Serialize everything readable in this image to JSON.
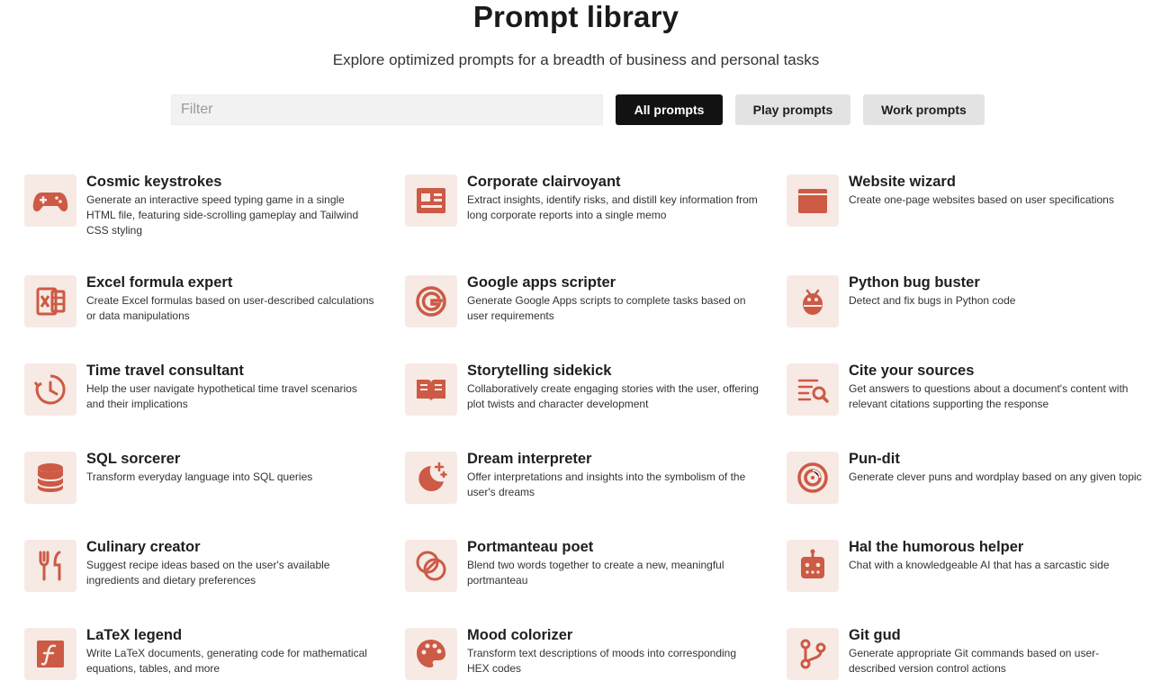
{
  "header": {
    "title": "Prompt library",
    "subtitle": "Explore optimized prompts for a breadth of business and personal tasks"
  },
  "filter": {
    "placeholder": "Filter",
    "value": ""
  },
  "tabs": {
    "all": "All prompts",
    "play": "Play prompts",
    "work": "Work prompts"
  },
  "colors": {
    "accent": "#cc5a45",
    "icon_bg": "#f7e9e4",
    "active_tab": "#121212",
    "inactive_tab": "#e3e3e3"
  },
  "cards": [
    {
      "title": "Cosmic keystrokes",
      "description": "Generate an interactive speed typing game in a single HTML file, featuring side-scrolling gameplay and Tailwind CSS styling",
      "icon": "gamepad-icon"
    },
    {
      "title": "Corporate clairvoyant",
      "description": "Extract insights, identify risks, and distill key information from long corporate reports into a single memo",
      "icon": "newspaper-icon"
    },
    {
      "title": "Website wizard",
      "description": "Create one-page websites based on user specifications",
      "icon": "browser-window-icon"
    },
    {
      "title": "Excel formula expert",
      "description": "Create Excel formulas based on user-described calculations or data manipulations",
      "icon": "excel-icon"
    },
    {
      "title": "Google apps scripter",
      "description": "Generate Google Apps scripts to complete tasks based on user requirements",
      "icon": "google-icon"
    },
    {
      "title": "Python bug buster",
      "description": "Detect and fix bugs in Python code",
      "icon": "bug-icon"
    },
    {
      "title": "Time travel consultant",
      "description": "Help the user navigate hypothetical time travel scenarios and their implications",
      "icon": "time-travel-icon"
    },
    {
      "title": "Storytelling sidekick",
      "description": "Collaboratively create engaging stories with the user, offering plot twists and character development",
      "icon": "book-icon"
    },
    {
      "title": "Cite your sources",
      "description": "Get answers to questions about a document's content with relevant citations supporting the response",
      "icon": "search-document-icon"
    },
    {
      "title": "SQL sorcerer",
      "description": "Transform everyday language into SQL queries",
      "icon": "database-icon"
    },
    {
      "title": "Dream interpreter",
      "description": "Offer interpretations and insights into the symbolism of the user's dreams",
      "icon": "moon-stars-icon"
    },
    {
      "title": "Pun-dit",
      "description": "Generate clever puns and wordplay based on any given topic",
      "icon": "spiral-icon"
    },
    {
      "title": "Culinary creator",
      "description": "Suggest recipe ideas based on the user's available ingredients and dietary preferences",
      "icon": "utensils-icon"
    },
    {
      "title": "Portmanteau poet",
      "description": "Blend two words together to create a new, meaningful portmanteau",
      "icon": "overlap-circles-icon"
    },
    {
      "title": "Hal the humorous helper",
      "description": "Chat with a knowledgeable AI that has a sarcastic side",
      "icon": "robot-icon"
    },
    {
      "title": "LaTeX legend",
      "description": "Write LaTeX documents, generating code for mathematical equations, tables, and more",
      "icon": "function-icon"
    },
    {
      "title": "Mood colorizer",
      "description": "Transform text descriptions of moods into corresponding HEX codes",
      "icon": "palette-icon"
    },
    {
      "title": "Git gud",
      "description": "Generate appropriate Git commands based on user-described version control actions",
      "icon": "git-branch-icon"
    }
  ]
}
